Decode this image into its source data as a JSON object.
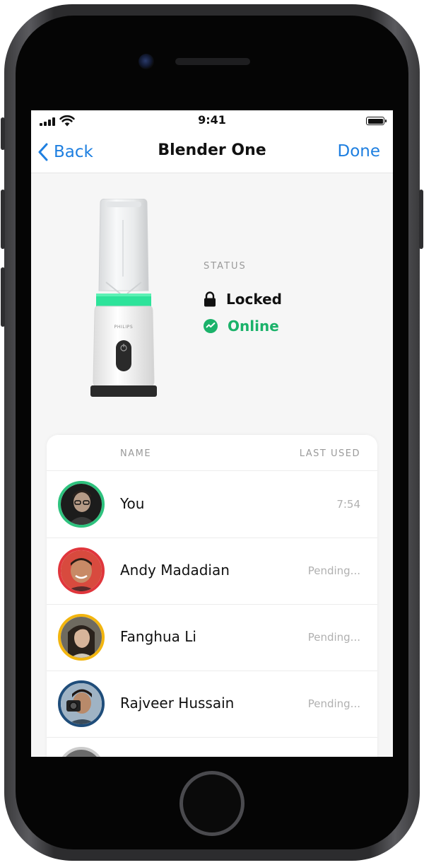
{
  "status_bar": {
    "time": "9:41"
  },
  "nav": {
    "back_label": "Back",
    "title": "Blender One",
    "done_label": "Done"
  },
  "device": {
    "brand": "PHILIPS",
    "status_heading": "STATUS",
    "lock_state": "Locked",
    "connection_state": "Online",
    "accent_color": "#2de39a",
    "online_color": "#1bb26a"
  },
  "users": {
    "header_name": "NAME",
    "header_last_used": "LAST USED",
    "rows": [
      {
        "name": "You",
        "last_used": "7:54",
        "ring_color": "#2ec27e"
      },
      {
        "name": "Andy Madadian",
        "last_used": "Pending...",
        "ring_color": "#e0363c"
      },
      {
        "name": "Fanghua Li",
        "last_used": "Pending...",
        "ring_color": "#f2b50f"
      },
      {
        "name": "Rajveer Hussain",
        "last_used": "Pending...",
        "ring_color": "#1f4d7a"
      }
    ]
  },
  "colors": {
    "link": "#1e7fe0",
    "screen_bg": "#f6f6f6"
  }
}
